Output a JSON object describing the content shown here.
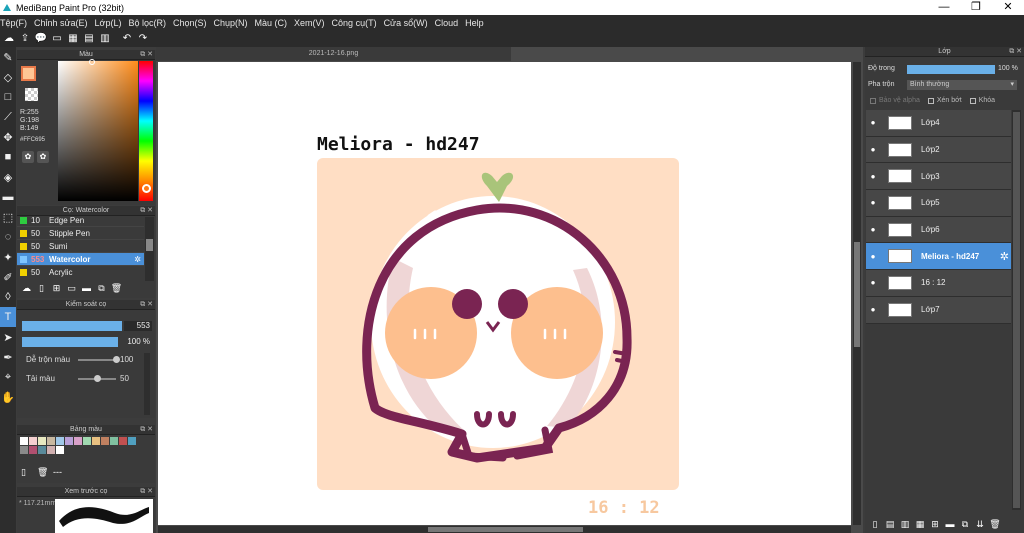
{
  "window": {
    "title": "MediBang Paint Pro (32bit)",
    "minimize": "—",
    "maximize": "❐",
    "close": "✕"
  },
  "menu": [
    "Tệp(F)",
    "Chỉnh sửa(E)",
    "Lớp(L)",
    "Bộ lọc(R)",
    "Chọn(S)",
    "Chụp(N)",
    "Màu (C)",
    "Xem(V)",
    "Công cụ(T)",
    "Cửa sổ(W)",
    "Cloud",
    "Help"
  ],
  "document": {
    "tab": "2021-12-16.png"
  },
  "color_panel": {
    "title": "Màu",
    "r": "R:255",
    "g": "G:198",
    "b": "B:149",
    "hex": "#FFC695",
    "foreground": "#ffc695"
  },
  "brush_panel": {
    "title": "Cọ: Watercolor",
    "items": [
      {
        "size": "10",
        "name": "Edge Pen",
        "color": "#2ecc40"
      },
      {
        "size": "50",
        "name": "Stipple Pen",
        "color": "#f0d000"
      },
      {
        "size": "50",
        "name": "Sumi",
        "color": "#f0d000"
      },
      {
        "size": "553",
        "name": "Watercolor",
        "color": "#7fc6ff"
      },
      {
        "size": "50",
        "name": "Acrylic",
        "color": "#f0d000"
      }
    ]
  },
  "brush_control": {
    "title": "Kiểm soát cọ",
    "size_value": "553",
    "opacity_value": "100 %",
    "blend_label": "Dễ trộn màu",
    "blend_value": "100",
    "blend_level": 1.0,
    "paint_label": "Tải màu",
    "paint_value": "50",
    "paint_level": 0.5
  },
  "palette": {
    "title": "Bảng màu",
    "colors": [
      "#ffffff",
      "#f5d0d0",
      "#e8e8c0",
      "#c8b8a0",
      "#a0c8e8",
      "#b8a0d8",
      "#d8a0c8",
      "#a0d8b0",
      "#e8c080",
      "#c08060",
      "#80c0a0",
      "#c05050",
      "#50a0c0",
      "#8a8a8a",
      "#b05070",
      "#5a8a9a",
      "#d0b0b0",
      "#ffffff"
    ],
    "extra": "---"
  },
  "preview": {
    "title": "Xem trước cọ",
    "zoom": "* 117.21mm"
  },
  "artwork": {
    "title": "Meliora - hd247",
    "ratio": "16 : 12"
  },
  "layer_panel": {
    "title": "Lớp",
    "opacity_label": "Độ trong",
    "opacity_value": "100 %",
    "opacity_level": 1.0,
    "blend_label": "Pha trộn",
    "blend_value": "Bình thường",
    "protect_alpha": "Bảo vệ alpha",
    "clipping": "Xén bớt",
    "lock": "Khóa",
    "layers": [
      {
        "name": "Lớp4"
      },
      {
        "name": "Lớp2"
      },
      {
        "name": "Lớp3"
      },
      {
        "name": "Lớp5"
      },
      {
        "name": "Lớp6"
      },
      {
        "name": "Meliora - hd247"
      },
      {
        "name": "16 : 12"
      },
      {
        "name": "Lớp7"
      }
    ]
  }
}
